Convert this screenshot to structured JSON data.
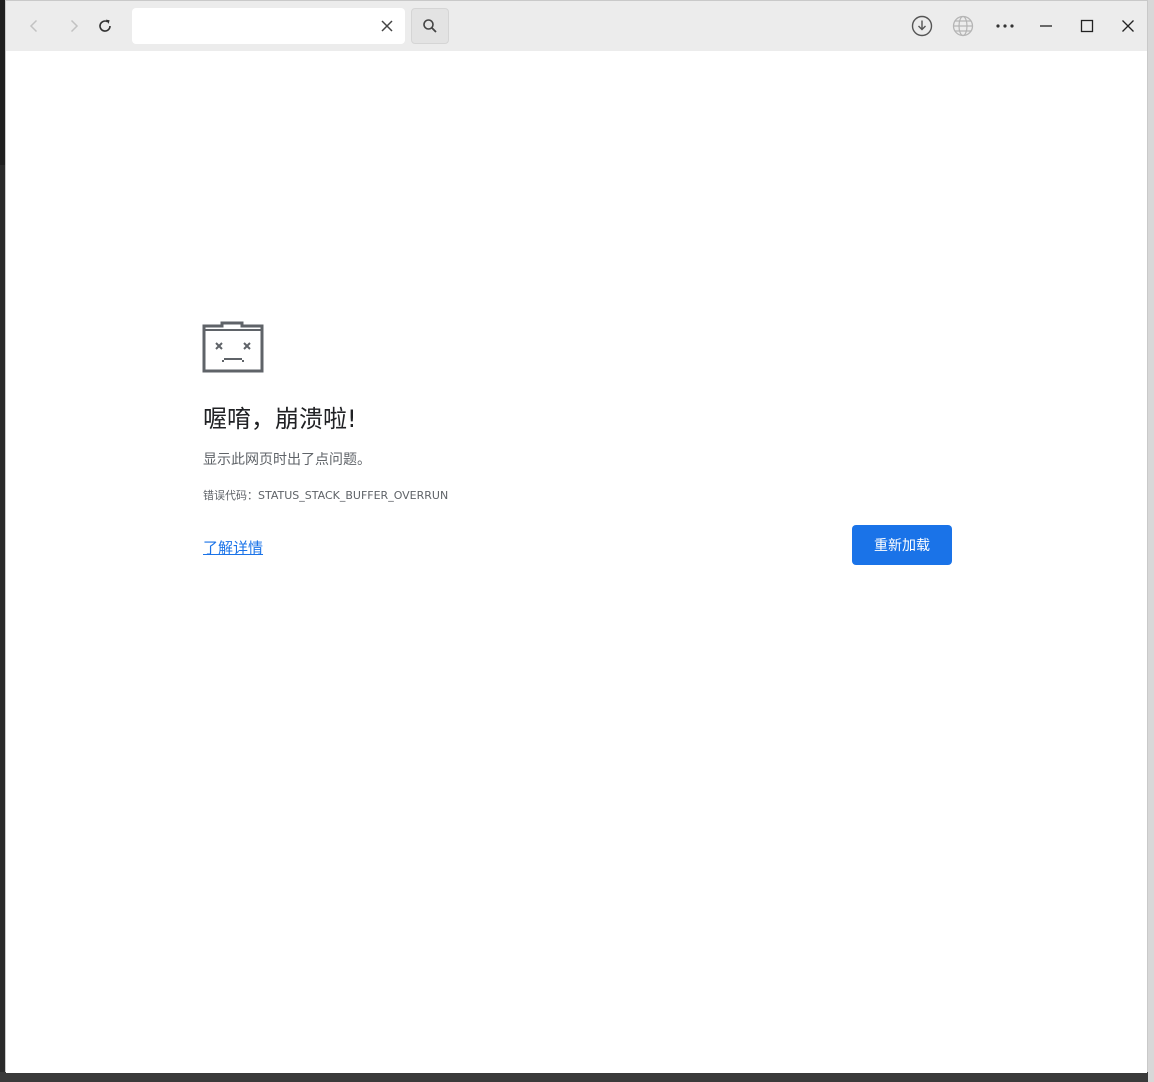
{
  "toolbar": {
    "address_value": "",
    "address_placeholder": "",
    "icons": {
      "back": "arrow-left-icon",
      "forward": "arrow-right-icon",
      "reload": "reload-icon",
      "clear": "close-icon",
      "search": "search-icon",
      "download": "download-icon",
      "globe": "globe-icon",
      "more": "more-icon",
      "minimize": "minimize-icon",
      "maximize": "maximize-icon",
      "close": "close-window-icon"
    }
  },
  "error_page": {
    "icon": "sad-folder-icon",
    "title": "喔唷，崩溃啦!",
    "description": "显示此网页时出了点问题。",
    "error_code": "错误代码：STATUS_STACK_BUFFER_OVERRUN",
    "learn_more": "了解详情",
    "reload_button": "重新加载"
  },
  "colors": {
    "accent": "#1a73e8",
    "toolbar_bg": "#ececec",
    "title_text": "#202124",
    "secondary_text": "#5f6368"
  }
}
